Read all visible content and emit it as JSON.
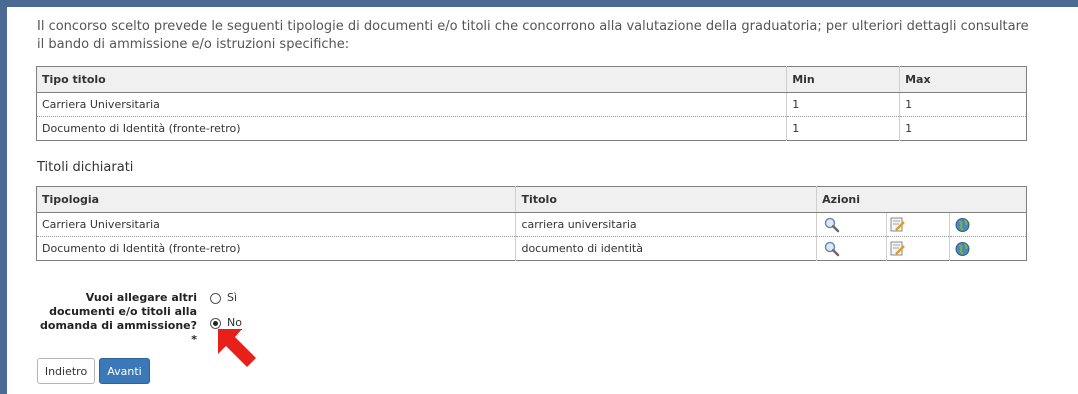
{
  "intro_text": "Il concorso scelto prevede le seguenti tipologie di documenti e/o titoli che concorrono alla valutazione della graduatoria; per ulteriori dettagli consultare il bando di ammissione e/o istruzioni specifiche:",
  "titles_table": {
    "headers": {
      "tipo": "Tipo titolo",
      "min": "Min",
      "max": "Max"
    },
    "rows": [
      {
        "tipo": "Carriera Universitaria",
        "min": "1",
        "max": "1"
      },
      {
        "tipo": "Documento di Identità (fronte-retro)",
        "min": "1",
        "max": "1"
      }
    ]
  },
  "declared_section_title": "Titoli dichiarati",
  "declared_table": {
    "headers": {
      "tipologia": "Tipologia",
      "titolo": "Titolo",
      "azioni": "Azioni"
    },
    "rows": [
      {
        "tipologia": "Carriera Universitaria",
        "titolo": "carriera universitaria"
      },
      {
        "tipologia": "Documento di Identità (fronte-retro)",
        "titolo": "documento di identità"
      }
    ],
    "action_icons": [
      "magnifier-icon",
      "edit-document-icon",
      "globe-icon"
    ]
  },
  "question": {
    "label": "Vuoi allegare altri documenti e/o titoli alla domanda di ammissione?*",
    "options": [
      "Sì",
      "No"
    ],
    "selected": "No"
  },
  "buttons": {
    "back": "Indietro",
    "next": "Avanti"
  },
  "colors": {
    "frame": "#4a6a94",
    "primary_button": "#3b78b8",
    "arrow": "#e8201a"
  }
}
